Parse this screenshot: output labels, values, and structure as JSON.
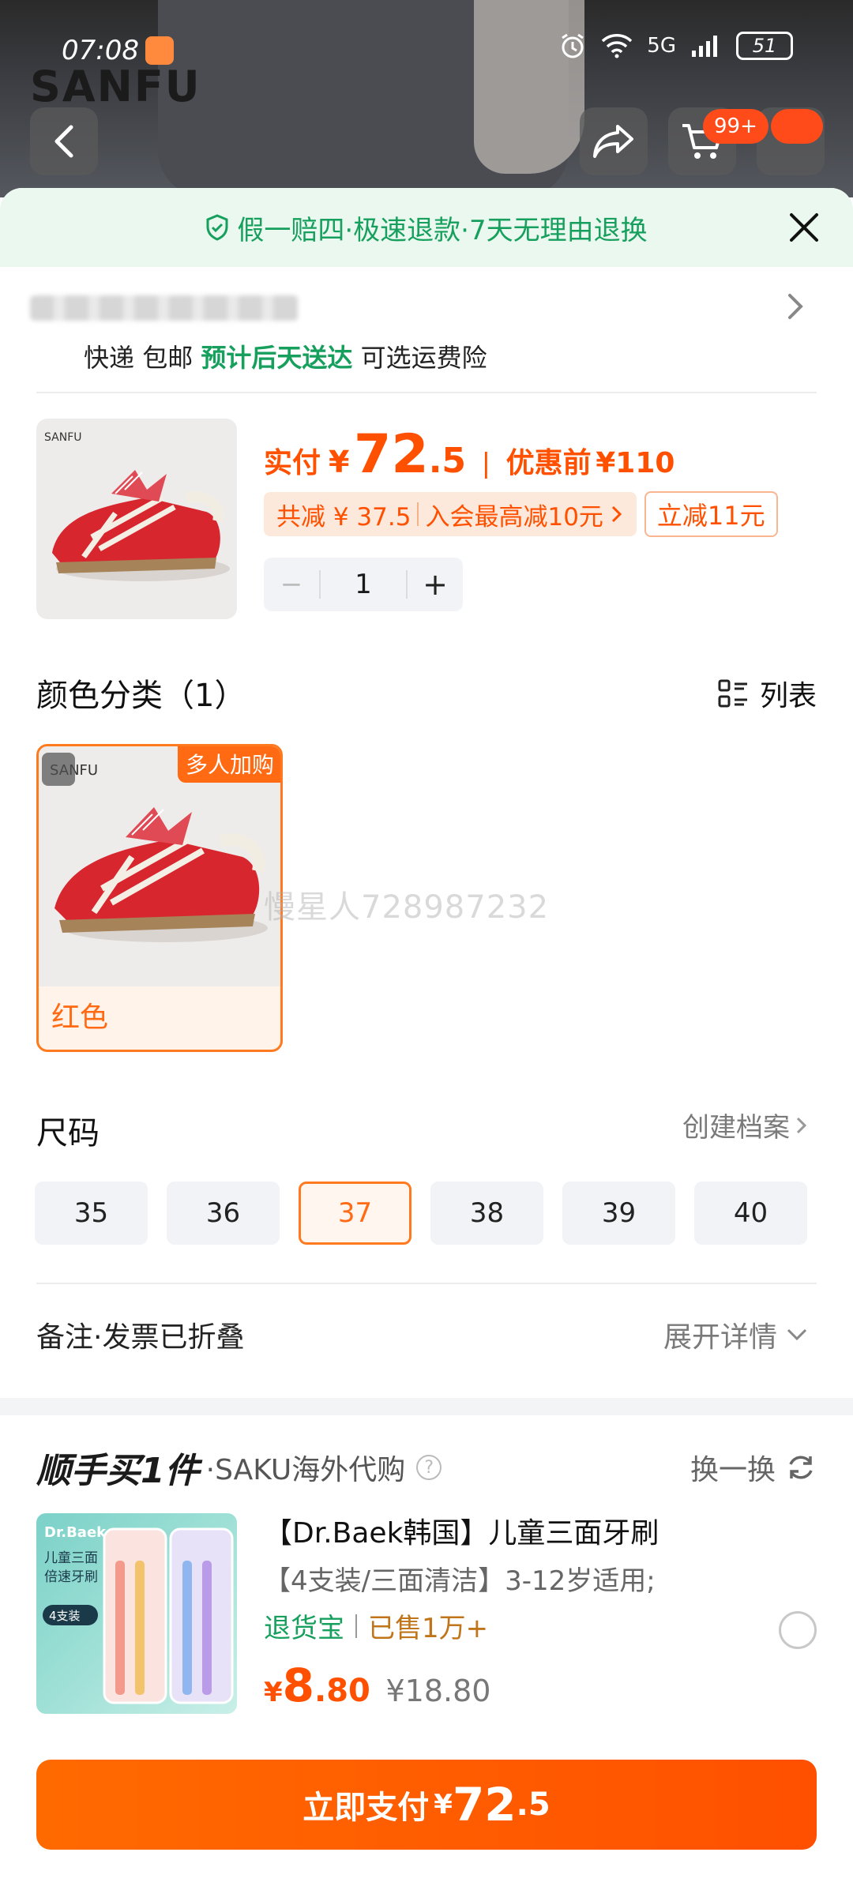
{
  "status_bar": {
    "time": "07:08",
    "network": "5G",
    "battery": "51"
  },
  "top": {
    "background_logo": "SANFU",
    "cart_badge": "99+"
  },
  "guarantee_banner": {
    "text": "假一赔四·极速退款·7天无理由退换"
  },
  "delivery": {
    "courier": "快递",
    "shipping": "包邮",
    "eta": "预计后天送达",
    "insurance": "可选运费险"
  },
  "product": {
    "paid_label": "实付",
    "currency": "¥",
    "price_int": "72",
    "price_dec": ".5",
    "separator": "|",
    "original_label": "优惠前",
    "original_price": "¥110",
    "discount_total": "共减 ¥ 37.5",
    "member_discount": "入会最高减10元",
    "coupon": "立减11元",
    "quantity": "1",
    "minus": "−",
    "plus": "+",
    "thumb_logo": "SANFU"
  },
  "color_section": {
    "title": "颜色分类（1）",
    "view_toggle": "列表",
    "options": [
      {
        "name": "红色",
        "tag": "多人加购",
        "selected": true
      }
    ],
    "thumb_logo": "SANFU"
  },
  "watermark": "慢星人728987232",
  "size_section": {
    "title": "尺码",
    "link": "创建档案",
    "sizes": [
      "35",
      "36",
      "37",
      "38",
      "39",
      "40"
    ],
    "selected": "37"
  },
  "remark": {
    "label": "备注·发票已折叠",
    "expand": "展开详情"
  },
  "recommend": {
    "brand": "顺手买1件",
    "store": "·SAKU海外代购",
    "swap": "换一换",
    "title": "【Dr.Baek韩国】儿童三面牙刷",
    "desc": "【4支装/三面清洁】3-12岁适用;",
    "tag_return": "退货宝",
    "tag_sold": "已售1万+",
    "currency": "¥",
    "price_int": "8",
    "price_dec": ".80",
    "original_price": "¥18.80",
    "thumb": {
      "brand": "Dr.Baek",
      "line1": "儿童三面",
      "line2": "倍速牙刷",
      "count": "4支装"
    }
  },
  "pay_button": {
    "label": "立即支付",
    "currency": "¥",
    "price_int": "72",
    "price_dec": ".5"
  },
  "colors": {
    "accent": "#ff5000",
    "green": "#17a05d",
    "selected_border": "#ff7a1f"
  }
}
